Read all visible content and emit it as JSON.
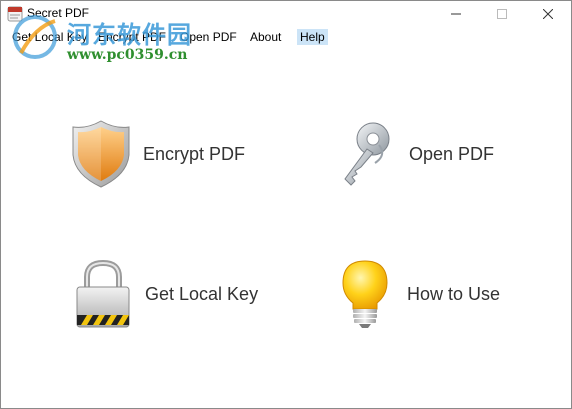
{
  "window": {
    "title": "Secret PDF"
  },
  "menu": {
    "items": [
      {
        "label": "Get Local Key",
        "active": false
      },
      {
        "label": "Encrypt PDF",
        "active": false
      },
      {
        "label": "Open PDF",
        "active": false
      },
      {
        "label": "About",
        "active": false
      },
      {
        "label": "Help",
        "active": true
      }
    ]
  },
  "watermark": {
    "site_name": "河东软件园",
    "url": "www.pc0359.cn"
  },
  "features": {
    "encrypt": {
      "label": "Encrypt PDF",
      "icon": "shield-icon"
    },
    "open": {
      "label": "Open PDF",
      "icon": "key-icon"
    },
    "local_key": {
      "label": "Get Local Key",
      "icon": "padlock-icon"
    },
    "how_to": {
      "label": "How to Use",
      "icon": "lightbulb-icon"
    }
  },
  "colors": {
    "menu_highlight": "#cce4f7",
    "watermark_blue": "#3a9ad9",
    "watermark_green": "#2f8f2f",
    "shield_orange": "#f0a030",
    "bulb_yellow": "#ffd21a"
  }
}
